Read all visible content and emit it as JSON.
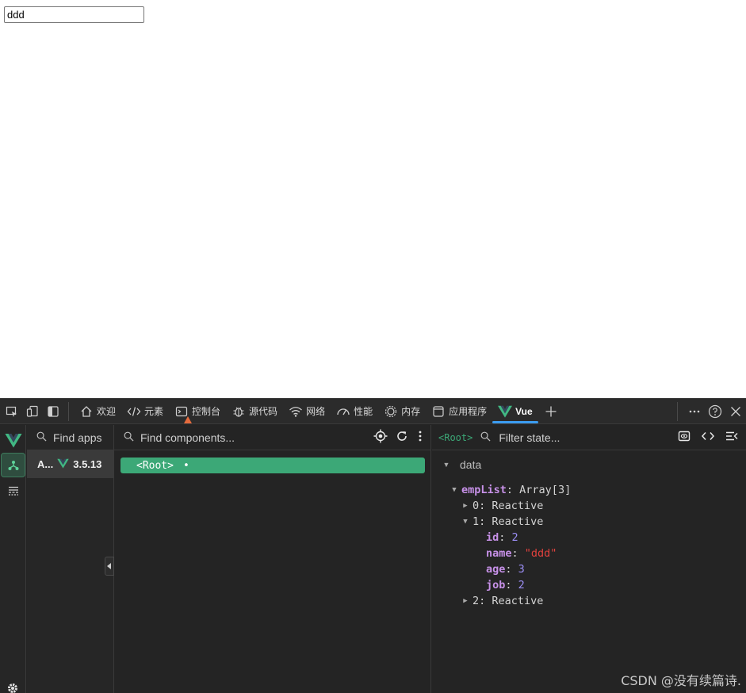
{
  "page": {
    "input_value": "ddd"
  },
  "tabbar": {
    "tabs": [
      {
        "label": "欢迎",
        "icon": "home-icon"
      },
      {
        "label": "元素",
        "icon": "code-icon"
      },
      {
        "label": "控制台",
        "icon": "console-icon"
      },
      {
        "label": "源代码",
        "icon": "bug-icon"
      },
      {
        "label": "网络",
        "icon": "wifi-icon"
      },
      {
        "label": "性能",
        "icon": "performance-icon"
      },
      {
        "label": "内存",
        "icon": "memory-icon"
      },
      {
        "label": "应用程序",
        "icon": "application-icon"
      },
      {
        "label": "Vue",
        "icon": "vue-logo-icon"
      }
    ],
    "active_tab": "Vue"
  },
  "apps": {
    "search_placeholder": "Find apps",
    "items": [
      {
        "name": "A...",
        "version": "3.5.13"
      }
    ]
  },
  "components": {
    "search_placeholder": "Find components...",
    "root": {
      "label": "<Root>",
      "dot": "•"
    }
  },
  "state": {
    "breadcrumb": "<Root>",
    "search_placeholder": "Filter state...",
    "section": "data",
    "tree": {
      "empList": {
        "key": "empList",
        "type": "Array[3]"
      },
      "item0": {
        "key": "0",
        "type": "Reactive"
      },
      "item1": {
        "key": "1",
        "type": "Reactive"
      },
      "id": {
        "key": "id",
        "value": "2"
      },
      "name": {
        "key": "name",
        "value": "\"ddd\""
      },
      "age": {
        "key": "age",
        "value": "3"
      },
      "job": {
        "key": "job",
        "value": "2"
      },
      "item2": {
        "key": "2",
        "type": "Reactive"
      }
    }
  },
  "watermark": "CSDN @没有续篇诗.",
  "colors": {
    "vue_green": "#3ca877",
    "accent_blue": "#3b9cf0",
    "warning": "#e56b3d"
  }
}
